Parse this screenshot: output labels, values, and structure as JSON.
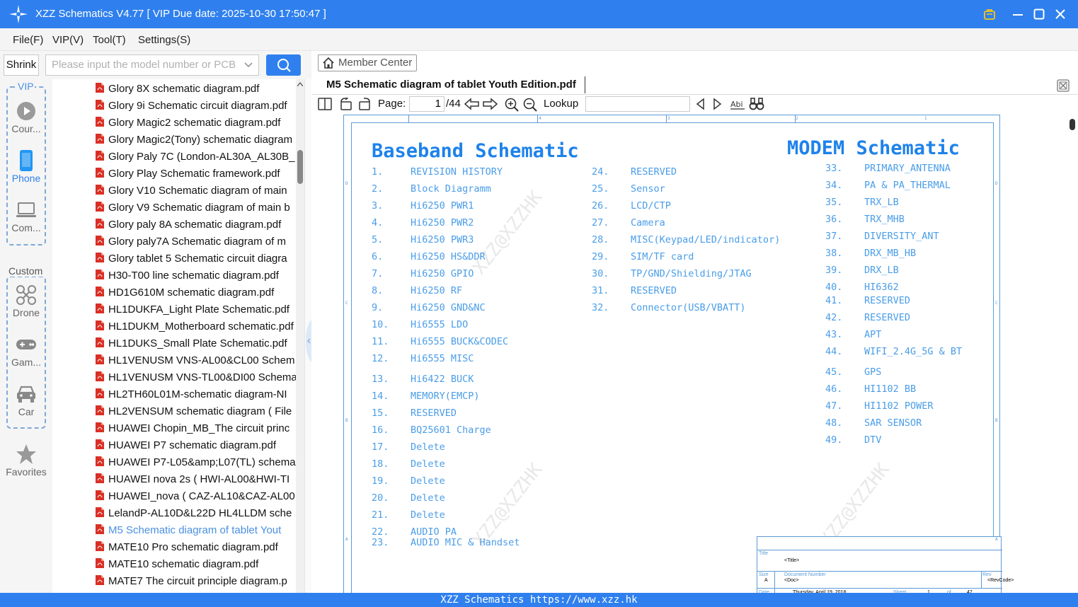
{
  "window": {
    "title": "XZZ Schematics V4.77 [ VIP Due date: 2025-10-30 17:50:47 ]",
    "accent_color": "#2f80ee"
  },
  "menu": [
    "File(F)",
    "VIP(V)",
    "Tool(T)",
    "Settings(S)"
  ],
  "sidebar": {
    "shrink_label": "Shrink",
    "search_placeholder": "Please input the model number or PCB",
    "vip_label": "VIP",
    "custom_label": "Custom",
    "categories": [
      {
        "label": "Cour...",
        "icon": "play-circle-icon"
      },
      {
        "label": "Phone",
        "icon": "phone-icon"
      },
      {
        "label": "Com...",
        "icon": "laptop-icon"
      },
      {
        "label": "Drone",
        "icon": "drone-icon"
      },
      {
        "label": "Gam...",
        "icon": "gamepad-icon"
      },
      {
        "label": "Car",
        "icon": "car-icon"
      },
      {
        "label": "Favorites",
        "icon": "star-icon"
      }
    ],
    "files": [
      "Glory 8X schematic diagram.pdf",
      "Glory 9i Schematic circuit diagram.pdf",
      "Glory Magic2 schematic diagram.pdf",
      "Glory Magic2(Tony) schematic diagram",
      "Glory Paly 7C (London-AL30A_AL30B_",
      "Glory Play Schematic framework.pdf",
      "Glory V10 Schematic diagram of main",
      "Glory V9 Schematic diagram of main b",
      "Glory paly 8A schematic diagram.pdf",
      "Glory paly7A Schematic diagram of m",
      "Glory tablet 5 Schematic circuit diagra",
      "H30-T00 line schematic diagram.pdf",
      "HD1G610M schematic diagram.pdf",
      "HL1DUKFA_Light Plate Schematic.pdf",
      "HL1DUKM_Motherboard schematic.pdf",
      "HL1DUKS_Small Plate Schematic.pdf",
      "HL1VENUSM VNS-AL00&CL00 Schem",
      "HL1VENUSM VNS-TL00&DI00 Schema",
      "HL2TH60L01M-schematic diagram-NI",
      "HL2VENSUM schematic diagram ( File",
      "HUAWEI Chopin_MB_The circuit princ",
      "HUAWEI P7 schematic diagram.pdf",
      "HUAWEI P7-L05&amp;L07(TL) schema",
      "HUAWEI nova 2s ( HWI-AL00&HWI-TI",
      "HUAWEI_nova ( CAZ-AL10&CAZ-AL00",
      "LelandP-AL10D&L22D HL4LLDM sche",
      "M5 Schematic diagram of tablet Yout",
      "MATE10 Pro schematic diagram.pdf",
      "MATE10 schematic diagram.pdf",
      "MATE7 The circuit principle diagram.p"
    ],
    "selected_index": 26
  },
  "main": {
    "member_center": "Member Center",
    "doc_title": "M5 Schematic diagram of tablet Youth Edition.pdf",
    "page_label": "Page:",
    "page_current": "1",
    "page_total": "/44",
    "lookup_label": "Lookup"
  },
  "schematic": {
    "left_title": "Baseband Schematic",
    "right_title": "MODEM Schematic",
    "col1": [
      [
        "1.",
        "REVISION HISTORY"
      ],
      [
        "2.",
        "Block Diagramm"
      ],
      [
        "3.",
        "Hi6250 PWR1"
      ],
      [
        "4.",
        "Hi6250 PWR2"
      ],
      [
        "5.",
        "Hi6250 PWR3"
      ],
      [
        "6.",
        "Hi6250 HS&DDR"
      ],
      [
        "7.",
        "Hi6250 GPIO"
      ],
      [
        "8.",
        "Hi6250 RF"
      ],
      [
        "9.",
        "Hi6250 GND&NC"
      ],
      [
        "10.",
        "Hi6555 LDO"
      ],
      [
        "11.",
        "Hi6555 BUCK&CODEC"
      ],
      [
        "12.",
        "Hi6555 MISC"
      ],
      [
        "13.",
        "Hi6422 BUCK"
      ],
      [
        "14.",
        "MEMORY(EMCP)"
      ],
      [
        "15.",
        "RESERVED"
      ],
      [
        "16.",
        "BQ25601 Charge"
      ],
      [
        "17.",
        "Delete"
      ],
      [
        "18.",
        "Delete"
      ],
      [
        "19.",
        "Delete"
      ],
      [
        "20.",
        "Delete"
      ],
      [
        "21.",
        "Delete"
      ],
      [
        "22.",
        "AUDIO PA"
      ],
      [
        "23.",
        "AUDIO MIC & Handset"
      ]
    ],
    "col2": [
      [
        "24.",
        "RESERVED"
      ],
      [
        "25.",
        "Sensor"
      ],
      [
        "26.",
        "LCD/CTP"
      ],
      [
        "27.",
        "Camera"
      ],
      [
        "28.",
        "MISC(Keypad/LED/indicator)"
      ],
      [
        "29.",
        "SIM/TF card"
      ],
      [
        "30.",
        "TP/GND/Shielding/JTAG"
      ],
      [
        "31.",
        "RESERVED"
      ],
      [
        "32.",
        "Connector(USB/VBATT)"
      ]
    ],
    "col3": [
      [
        "33.",
        "PRIMARY_ANTENNA"
      ],
      [
        "34.",
        "PA & PA_THERMAL"
      ],
      [
        "35.",
        "TRX_LB"
      ],
      [
        "36.",
        "TRX_MHB"
      ],
      [
        "37.",
        "DIVERSITY_ANT"
      ],
      [
        "38.",
        "DRX_MB_HB"
      ],
      [
        "39.",
        "DRX_LB"
      ],
      [
        "40.",
        "HI6362"
      ],
      [
        "41.",
        "RESERVED"
      ],
      [
        "42.",
        "RESERVED"
      ],
      [
        "43.",
        "APT"
      ],
      [
        "44.",
        "WIFI_2.4G_5G & BT"
      ],
      [
        "45.",
        "GPS"
      ],
      [
        "46.",
        "HI1102 BB"
      ],
      [
        "47.",
        "HI1102 POWER"
      ],
      [
        "48.",
        "SAR SENSOR"
      ],
      [
        "49.",
        "DTV"
      ]
    ],
    "watermark": "XZZ@XZZHK",
    "titleblock": {
      "title_lbl": "Title",
      "title_val": "<Title>",
      "size_lbl": "Size",
      "size_val": "A",
      "docnum_lbl": "Document Number",
      "docnum_val": "<Doc>",
      "rev_lbl": "Rev",
      "rev_val": "<RevCode>",
      "date_lbl": "Date:",
      "date_val": "Thursday, April 19, 2018",
      "sheet_lbl": "Sheet",
      "sheet_val": "1",
      "of_lbl": "of",
      "of_val": "47"
    },
    "ruler_top": [
      "4",
      "3",
      "2",
      "1"
    ],
    "ruler_side": [
      "D",
      "C",
      "B",
      "A"
    ]
  },
  "status": "XZZ Schematics https://www.xzz.hk"
}
